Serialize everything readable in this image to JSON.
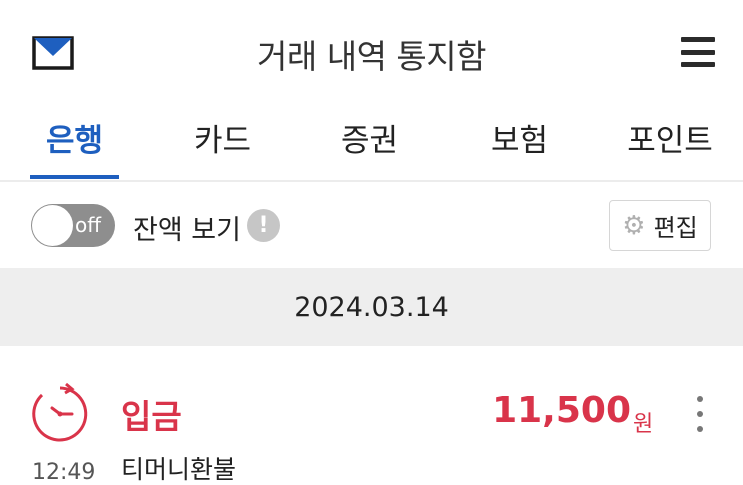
{
  "header": {
    "title": "거래 내역 통지함",
    "left_icon": "mail-icon",
    "right_icon": "hamburger-menu-icon"
  },
  "tabs": [
    {
      "label": "은행",
      "active": true
    },
    {
      "label": "카드",
      "active": false
    },
    {
      "label": "증권",
      "active": false
    },
    {
      "label": "보험",
      "active": false
    },
    {
      "label": "포인트",
      "active": false
    }
  ],
  "toolbar": {
    "toggle_state": "off",
    "balance_label": "잔액 보기",
    "info_icon": "!",
    "edit_label": "편집"
  },
  "date_group": "2024.03.14",
  "transactions": [
    {
      "time": "12:49",
      "type": "입금",
      "description": "티머니환불",
      "amount": "11,500",
      "unit": "원"
    }
  ],
  "colors": {
    "accent_blue": "#1e5fbf",
    "deposit_red": "#d9344a",
    "toggle_gray": "#8e8e8e",
    "date_bar_bg": "#eeeeee"
  }
}
